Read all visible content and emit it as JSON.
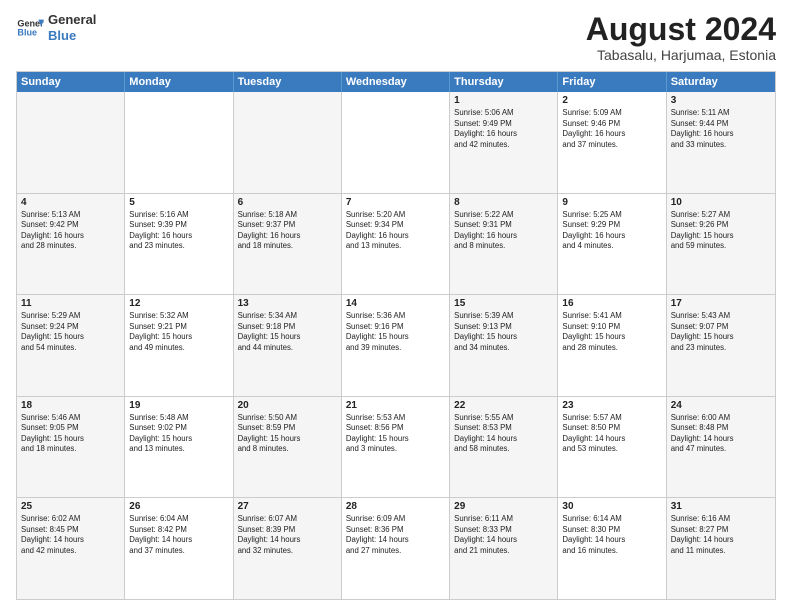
{
  "logo": {
    "line1": "General",
    "line2": "Blue"
  },
  "title": "August 2024",
  "subtitle": "Tabasalu, Harjumaa, Estonia",
  "weekdays": [
    "Sunday",
    "Monday",
    "Tuesday",
    "Wednesday",
    "Thursday",
    "Friday",
    "Saturday"
  ],
  "rows": [
    [
      {
        "day": "",
        "detail": ""
      },
      {
        "day": "",
        "detail": ""
      },
      {
        "day": "",
        "detail": ""
      },
      {
        "day": "",
        "detail": ""
      },
      {
        "day": "1",
        "detail": "Sunrise: 5:06 AM\nSunset: 9:49 PM\nDaylight: 16 hours\nand 42 minutes."
      },
      {
        "day": "2",
        "detail": "Sunrise: 5:09 AM\nSunset: 9:46 PM\nDaylight: 16 hours\nand 37 minutes."
      },
      {
        "day": "3",
        "detail": "Sunrise: 5:11 AM\nSunset: 9:44 PM\nDaylight: 16 hours\nand 33 minutes."
      }
    ],
    [
      {
        "day": "4",
        "detail": "Sunrise: 5:13 AM\nSunset: 9:42 PM\nDaylight: 16 hours\nand 28 minutes."
      },
      {
        "day": "5",
        "detail": "Sunrise: 5:16 AM\nSunset: 9:39 PM\nDaylight: 16 hours\nand 23 minutes."
      },
      {
        "day": "6",
        "detail": "Sunrise: 5:18 AM\nSunset: 9:37 PM\nDaylight: 16 hours\nand 18 minutes."
      },
      {
        "day": "7",
        "detail": "Sunrise: 5:20 AM\nSunset: 9:34 PM\nDaylight: 16 hours\nand 13 minutes."
      },
      {
        "day": "8",
        "detail": "Sunrise: 5:22 AM\nSunset: 9:31 PM\nDaylight: 16 hours\nand 8 minutes."
      },
      {
        "day": "9",
        "detail": "Sunrise: 5:25 AM\nSunset: 9:29 PM\nDaylight: 16 hours\nand 4 minutes."
      },
      {
        "day": "10",
        "detail": "Sunrise: 5:27 AM\nSunset: 9:26 PM\nDaylight: 15 hours\nand 59 minutes."
      }
    ],
    [
      {
        "day": "11",
        "detail": "Sunrise: 5:29 AM\nSunset: 9:24 PM\nDaylight: 15 hours\nand 54 minutes."
      },
      {
        "day": "12",
        "detail": "Sunrise: 5:32 AM\nSunset: 9:21 PM\nDaylight: 15 hours\nand 49 minutes."
      },
      {
        "day": "13",
        "detail": "Sunrise: 5:34 AM\nSunset: 9:18 PM\nDaylight: 15 hours\nand 44 minutes."
      },
      {
        "day": "14",
        "detail": "Sunrise: 5:36 AM\nSunset: 9:16 PM\nDaylight: 15 hours\nand 39 minutes."
      },
      {
        "day": "15",
        "detail": "Sunrise: 5:39 AM\nSunset: 9:13 PM\nDaylight: 15 hours\nand 34 minutes."
      },
      {
        "day": "16",
        "detail": "Sunrise: 5:41 AM\nSunset: 9:10 PM\nDaylight: 15 hours\nand 28 minutes."
      },
      {
        "day": "17",
        "detail": "Sunrise: 5:43 AM\nSunset: 9:07 PM\nDaylight: 15 hours\nand 23 minutes."
      }
    ],
    [
      {
        "day": "18",
        "detail": "Sunrise: 5:46 AM\nSunset: 9:05 PM\nDaylight: 15 hours\nand 18 minutes."
      },
      {
        "day": "19",
        "detail": "Sunrise: 5:48 AM\nSunset: 9:02 PM\nDaylight: 15 hours\nand 13 minutes."
      },
      {
        "day": "20",
        "detail": "Sunrise: 5:50 AM\nSunset: 8:59 PM\nDaylight: 15 hours\nand 8 minutes."
      },
      {
        "day": "21",
        "detail": "Sunrise: 5:53 AM\nSunset: 8:56 PM\nDaylight: 15 hours\nand 3 minutes."
      },
      {
        "day": "22",
        "detail": "Sunrise: 5:55 AM\nSunset: 8:53 PM\nDaylight: 14 hours\nand 58 minutes."
      },
      {
        "day": "23",
        "detail": "Sunrise: 5:57 AM\nSunset: 8:50 PM\nDaylight: 14 hours\nand 53 minutes."
      },
      {
        "day": "24",
        "detail": "Sunrise: 6:00 AM\nSunset: 8:48 PM\nDaylight: 14 hours\nand 47 minutes."
      }
    ],
    [
      {
        "day": "25",
        "detail": "Sunrise: 6:02 AM\nSunset: 8:45 PM\nDaylight: 14 hours\nand 42 minutes."
      },
      {
        "day": "26",
        "detail": "Sunrise: 6:04 AM\nSunset: 8:42 PM\nDaylight: 14 hours\nand 37 minutes."
      },
      {
        "day": "27",
        "detail": "Sunrise: 6:07 AM\nSunset: 8:39 PM\nDaylight: 14 hours\nand 32 minutes."
      },
      {
        "day": "28",
        "detail": "Sunrise: 6:09 AM\nSunset: 8:36 PM\nDaylight: 14 hours\nand 27 minutes."
      },
      {
        "day": "29",
        "detail": "Sunrise: 6:11 AM\nSunset: 8:33 PM\nDaylight: 14 hours\nand 21 minutes."
      },
      {
        "day": "30",
        "detail": "Sunrise: 6:14 AM\nSunset: 8:30 PM\nDaylight: 14 hours\nand 16 minutes."
      },
      {
        "day": "31",
        "detail": "Sunrise: 6:16 AM\nSunset: 8:27 PM\nDaylight: 14 hours\nand 11 minutes."
      }
    ]
  ]
}
